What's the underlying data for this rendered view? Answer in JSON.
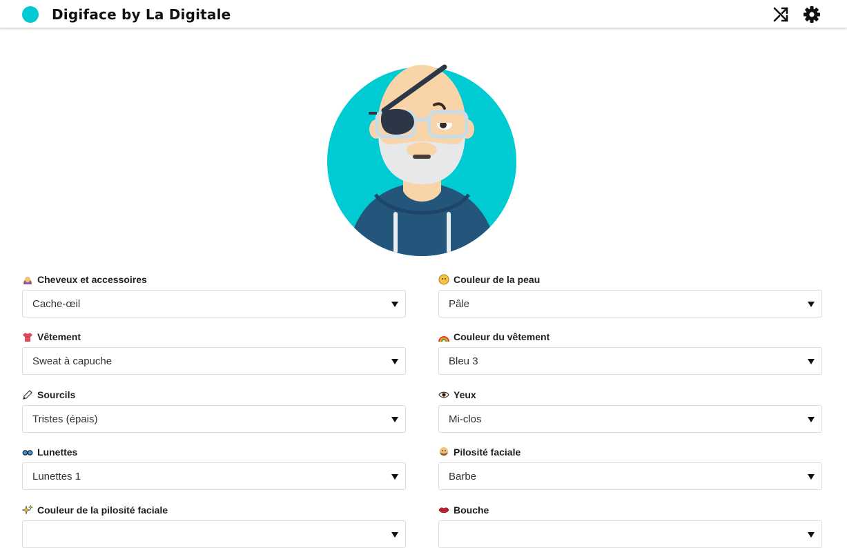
{
  "header": {
    "title": "Digiface by La Digitale",
    "brand_color": "#00cbd2",
    "actions": [
      {
        "name": "shuffle-icon"
      },
      {
        "name": "gear-icon"
      }
    ]
  },
  "avatar": {
    "background_color": "#00cbd2",
    "skin_color": "#f9d4a8",
    "clothing_color": "#24557b"
  },
  "fields": [
    {
      "id": "cheveux",
      "icon": "person-hair-icon",
      "label": "Cheveux et accessoires",
      "value": "Cache-œil"
    },
    {
      "id": "peau",
      "icon": "face-icon",
      "label": "Couleur de la peau",
      "value": "Pâle"
    },
    {
      "id": "vetement",
      "icon": "tshirt-icon",
      "label": "Vêtement",
      "value": "Sweat à capuche"
    },
    {
      "id": "couleur-vetement",
      "icon": "rainbow-icon",
      "label": "Couleur du vêtement",
      "value": "Bleu 3"
    },
    {
      "id": "sourcils",
      "icon": "pencil-icon",
      "label": "Sourcils",
      "value": "Tristes (épais)"
    },
    {
      "id": "yeux",
      "icon": "eye-icon",
      "label": "Yeux",
      "value": "Mi-clos"
    },
    {
      "id": "lunettes",
      "icon": "glasses-icon",
      "label": "Lunettes",
      "value": "Lunettes 1"
    },
    {
      "id": "pilosite",
      "icon": "bearded-face-icon",
      "label": "Pilosité faciale",
      "value": "Barbe"
    },
    {
      "id": "couleur-pilosite",
      "icon": "sparkles-icon",
      "label": "Couleur de la pilosité faciale",
      "value": ""
    },
    {
      "id": "bouche",
      "icon": "lips-icon",
      "label": "Bouche",
      "value": ""
    }
  ]
}
